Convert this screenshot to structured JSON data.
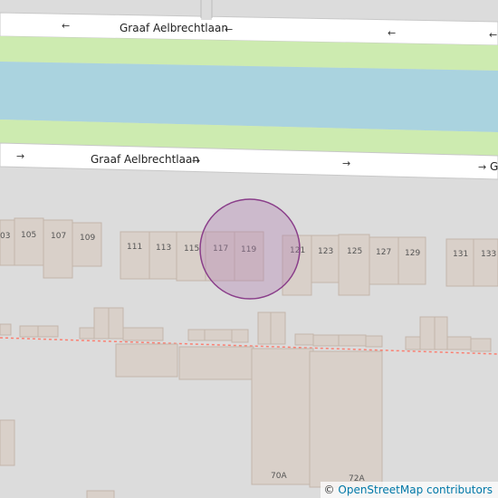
{
  "map": {
    "street_name": "Graaf Aelbrechtlaan",
    "street_name_partial": "G",
    "oneway_arrow_left": "←",
    "oneway_arrow_right": "→",
    "house_numbers_north_row": [
      "03",
      "105",
      "107",
      "109",
      "111",
      "113",
      "115",
      "117",
      "119",
      "121",
      "123",
      "125",
      "127",
      "129",
      "131",
      "133"
    ],
    "house_numbers_south": [
      "70A",
      "72A"
    ],
    "highlight_color": "#c8a0c8",
    "water_color": "#aad3df",
    "grass_color": "#cdebb0"
  },
  "attribution": {
    "symbol": "©",
    "text": "OpenStreetMap contributors"
  }
}
